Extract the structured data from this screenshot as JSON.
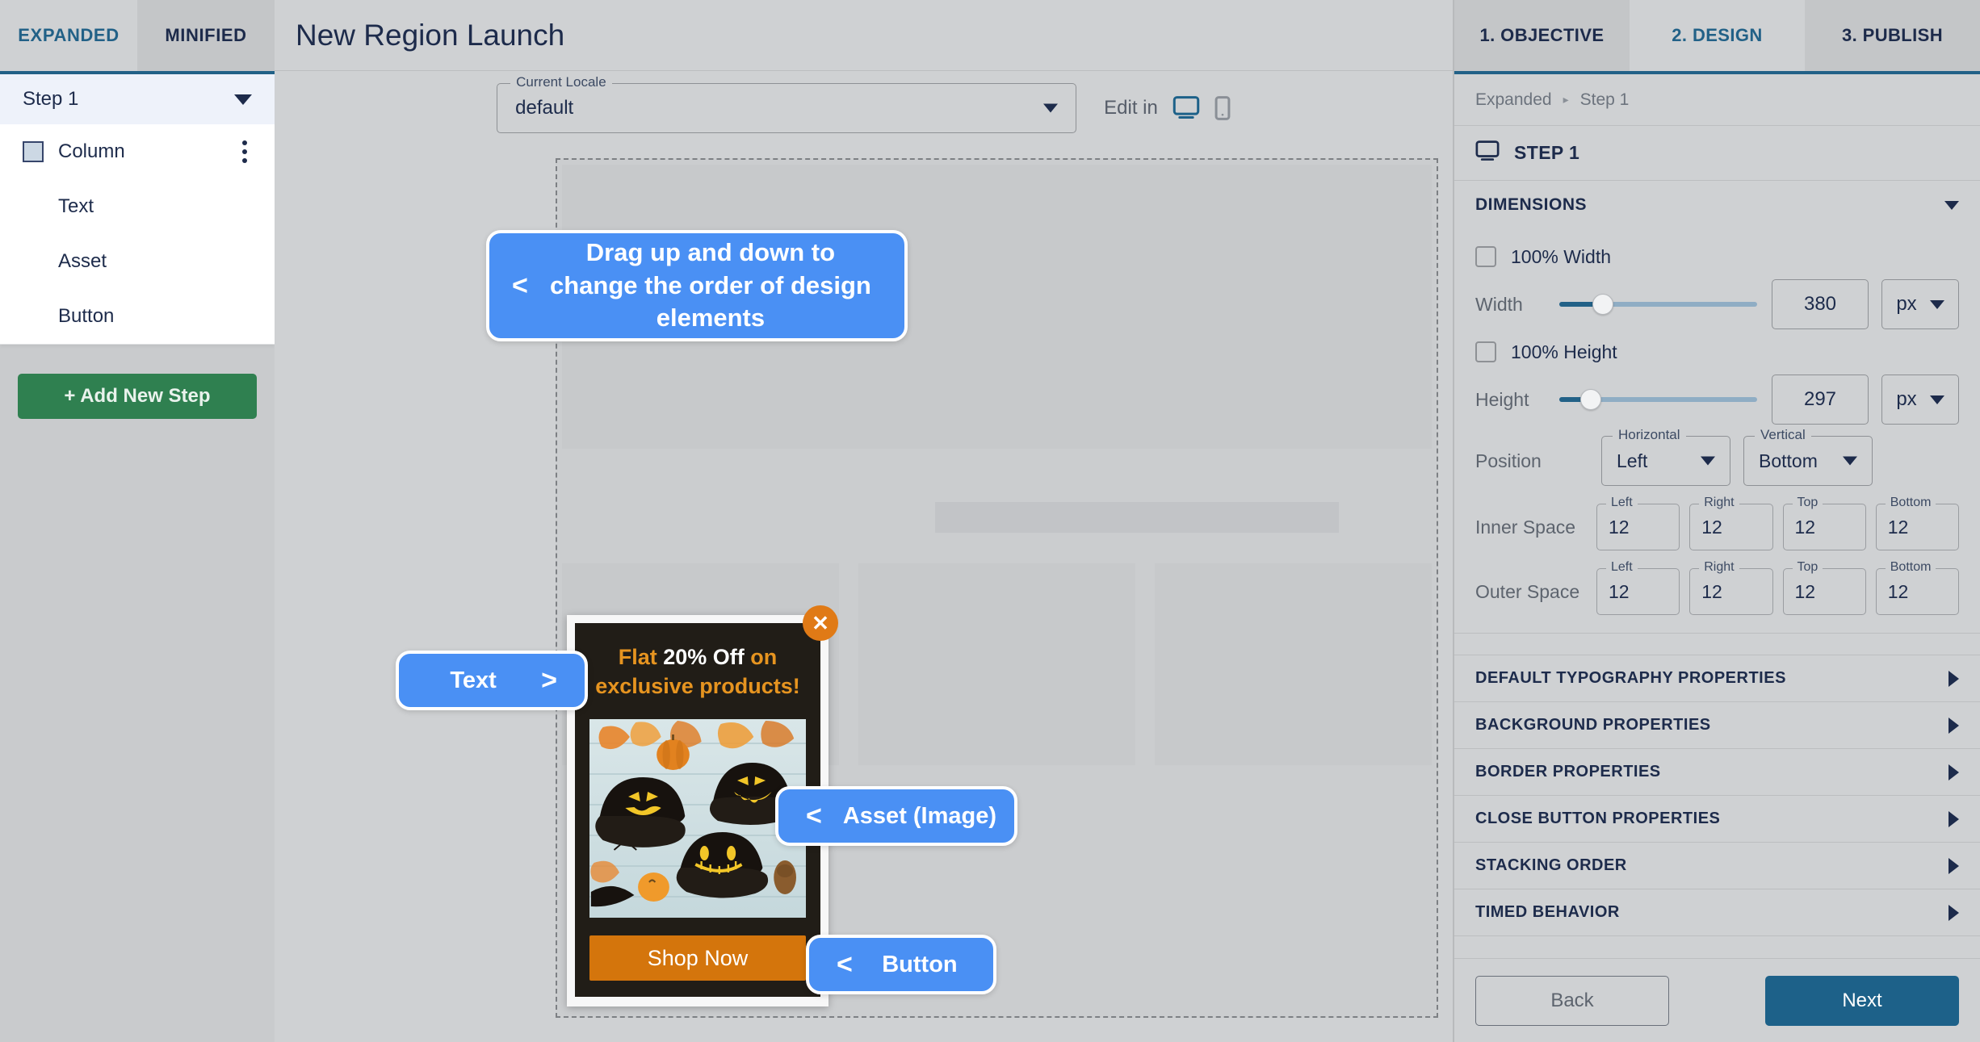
{
  "left_sidebar": {
    "tabs": [
      {
        "label": "EXPANDED",
        "active": true
      },
      {
        "label": "MINIFIED",
        "active": false
      }
    ],
    "step_group": {
      "label": "Step 1",
      "chevron_icon": "chevron-down-icon"
    },
    "elements": [
      {
        "label": "Column",
        "has_swatch": true,
        "has_kebab": true
      },
      {
        "label": "Text",
        "has_swatch": false,
        "has_kebab": false
      },
      {
        "label": "Asset",
        "has_swatch": false,
        "has_kebab": false
      },
      {
        "label": "Button",
        "has_swatch": false,
        "has_kebab": false
      }
    ],
    "add_step_label": "+ Add New Step"
  },
  "center": {
    "page_title": "New Region Launch",
    "locale": {
      "legend": "Current Locale",
      "value": "default",
      "chevron_icon": "chevron-down-icon"
    },
    "edit_in": {
      "label": "Edit in",
      "desktop_icon": "desktop-monitor-icon",
      "mobile_icon": "mobile-phone-icon",
      "active": "desktop"
    },
    "popup_preview": {
      "close_icon": "close-x-icon",
      "headline_parts": [
        {
          "text": "Flat ",
          "color": "orange"
        },
        {
          "text": "20% Off ",
          "color": "white"
        },
        {
          "text": "on exclusive products!",
          "color": "orange"
        }
      ],
      "headline_plain": "Flat 20% Off on exclusive products!",
      "image_alt": "halloween-jack-o-lantern-caps-photo",
      "cta_label": "Shop Now",
      "colors": {
        "background": "#211d17",
        "accent": "#e69420",
        "cta": "#d4750c",
        "close": "#e07a16"
      }
    }
  },
  "callouts": [
    {
      "id": "order",
      "text": "Drag up and down to change the order of design elements",
      "arrow": "<",
      "arrow_side": "left",
      "multiline": true
    },
    {
      "id": "text",
      "text": "Text",
      "arrow": ">",
      "arrow_side": "right",
      "multiline": false
    },
    {
      "id": "asset",
      "text": "Asset (Image)",
      "arrow": "<",
      "arrow_side": "left",
      "multiline": false
    },
    {
      "id": "button",
      "text": "Button",
      "arrow": "<",
      "arrow_side": "left",
      "multiline": false
    }
  ],
  "right_panel": {
    "tabs": [
      {
        "label": "1. OBJECTIVE",
        "active": false
      },
      {
        "label": "2. DESIGN",
        "active": true
      },
      {
        "label": "3. PUBLISH",
        "active": false
      }
    ],
    "breadcrumb": {
      "root": "Expanded",
      "separator": "▸",
      "current": "Step 1"
    },
    "step_header": {
      "icon": "desktop-monitor-icon",
      "label": "STEP 1"
    },
    "dimensions": {
      "section_title": "DIMENSIONS",
      "chevron_icon": "chevron-down-icon",
      "full_width": {
        "label": "100% Width",
        "checked": false
      },
      "width": {
        "label": "Width",
        "value": "380",
        "unit": "px",
        "slider_pct": 22
      },
      "full_height": {
        "label": "100% Height",
        "checked": false
      },
      "height": {
        "label": "Height",
        "value": "297",
        "unit": "px",
        "slider_pct": 16
      },
      "position": {
        "label": "Position",
        "horizontal": {
          "legend": "Horizontal",
          "value": "Left"
        },
        "vertical": {
          "legend": "Vertical",
          "value": "Bottom"
        }
      },
      "inner_space": {
        "label": "Inner Space",
        "fields": [
          {
            "legend": "Left",
            "value": "12"
          },
          {
            "legend": "Right",
            "value": "12"
          },
          {
            "legend": "Top",
            "value": "12"
          },
          {
            "legend": "Bottom",
            "value": "12"
          }
        ]
      },
      "outer_space": {
        "label": "Outer Space",
        "fields": [
          {
            "legend": "Left",
            "value": "12"
          },
          {
            "legend": "Right",
            "value": "12"
          },
          {
            "legend": "Top",
            "value": "12"
          },
          {
            "legend": "Bottom",
            "value": "12"
          }
        ]
      }
    },
    "accordions": [
      {
        "title": "DEFAULT TYPOGRAPHY PROPERTIES",
        "chevron_icon": "chevron-right-icon"
      },
      {
        "title": "BACKGROUND PROPERTIES",
        "chevron_icon": "chevron-right-icon"
      },
      {
        "title": "BORDER PROPERTIES",
        "chevron_icon": "chevron-right-icon"
      },
      {
        "title": "CLOSE BUTTON PROPERTIES",
        "chevron_icon": "chevron-right-icon"
      },
      {
        "title": "STACKING ORDER",
        "chevron_icon": "chevron-right-icon"
      },
      {
        "title": "TIMED BEHAVIOR",
        "chevron_icon": "chevron-right-icon"
      }
    ],
    "footer": {
      "back_label": "Back",
      "next_label": "Next"
    }
  },
  "theme": {
    "accent_blue": "#226187",
    "primary_button": "#1d6189",
    "add_step_green": "#2f8050",
    "callout_blue": "#4a90f4",
    "panel_bg": "#cfd1d3",
    "text_dark": "#1d2b4b"
  }
}
